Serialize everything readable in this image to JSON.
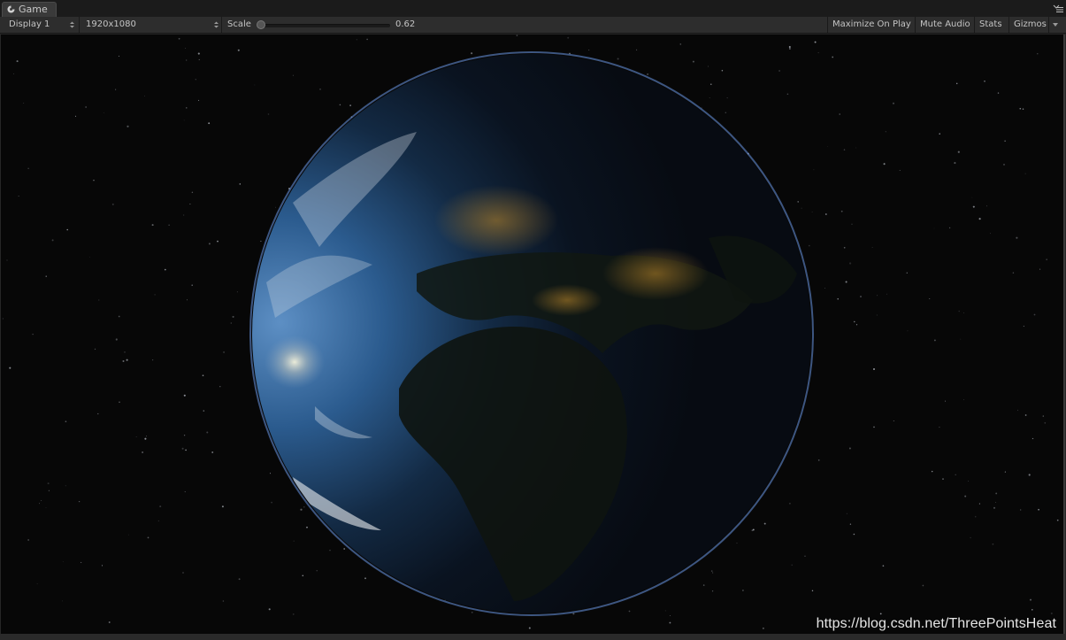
{
  "window": {
    "tab_label": "Game",
    "tab_icon": "game-controller-icon",
    "menu_icon": "tab-options-icon"
  },
  "toolbar": {
    "display_select": "Display 1",
    "resolution_select": "1920x1080",
    "scale_label": "Scale",
    "scale_value": "0.62",
    "scale_level": 0.0,
    "maximize_label": "Maximize On Play",
    "mute_label": "Mute Audio",
    "stats_label": "Stats",
    "gizmos_label": "Gizmos"
  },
  "viewport": {
    "watermark": "https://blog.csdn.net/ThreePointsHeat"
  },
  "colors": {
    "editor_bg": "#2d2d2d",
    "space_bg": "#070707",
    "ocean_lit": "#2d5f96",
    "atmosphere": "#5f8fe0",
    "city_lights": "#b8862a"
  }
}
